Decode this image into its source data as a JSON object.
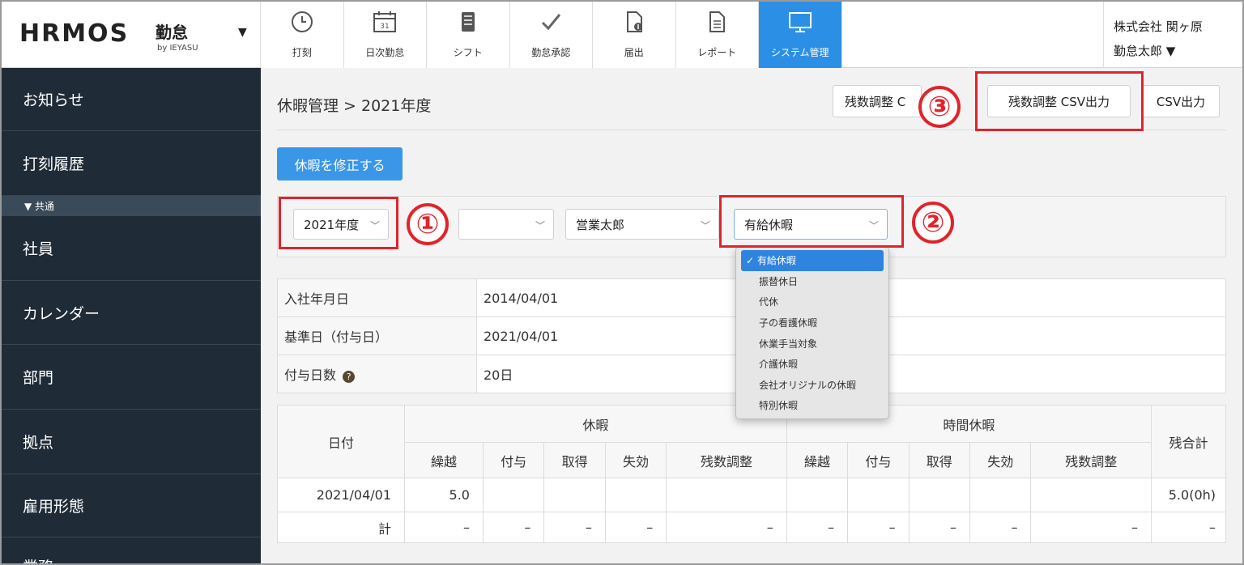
{
  "header": {
    "logo_text": "HRMOS",
    "logo_kintai": "勤怠",
    "logo_by": "by IEYASU",
    "logo_caret": "▼",
    "company": "株式会社 関ヶ原",
    "user": "勤怠太郎 ▼",
    "tabs": [
      {
        "label": "打刻",
        "icon": "clock-icon"
      },
      {
        "label": "日次勤怠",
        "icon": "calendar-icon"
      },
      {
        "label": "シフト",
        "icon": "notebook-icon"
      },
      {
        "label": "勤怠承認",
        "icon": "checkmark-icon"
      },
      {
        "label": "届出",
        "icon": "document-icon"
      },
      {
        "label": "レポート",
        "icon": "report-icon"
      },
      {
        "label": "システム管理",
        "icon": "monitor-icon"
      }
    ]
  },
  "sidebar": {
    "items": [
      "お知らせ",
      "打刻履歴"
    ],
    "section": "▼ 共通",
    "items2": [
      "社員",
      "カレンダー",
      "部門",
      "拠点",
      "雇用形態",
      "業務"
    ]
  },
  "main": {
    "breadcrumb": "休暇管理 > 2021年度",
    "btn_zansu_partial": "残数調整 C",
    "btn_zansu_csv": "残数調整 CSV出力",
    "btn_csv": "CSV出力",
    "btn_edit": "休暇を修正する",
    "filters": {
      "year": "2021年度",
      "blank": "",
      "employee": "営業太郎",
      "leave_type": "有給休暇"
    },
    "annotations": [
      "①",
      "②",
      "③"
    ],
    "dropdown": [
      "✓ 有給休暇",
      "振替休日",
      "代休",
      "子の看護休暇",
      "休業手当対象",
      "介護休暇",
      "会社オリジナルの休暇",
      "特別休暇"
    ],
    "info": [
      {
        "label": "入社年月日",
        "value": "2014/04/01"
      },
      {
        "label": "基準日（付与日）",
        "value": "2021/04/01"
      },
      {
        "label": "付与日数",
        "value": "20日",
        "help": "?"
      }
    ],
    "history": {
      "col_date": "日付",
      "group1": "休暇",
      "group2": "時間休暇",
      "col_total": "残合計",
      "subcols": [
        "繰越",
        "付与",
        "取得",
        "失効",
        "残数調整",
        "繰越",
        "付与",
        "取得",
        "失効",
        "残数調整"
      ],
      "rows": [
        {
          "date": "2021/04/01",
          "cells": [
            "5.0",
            "",
            "",
            "",
            "",
            "",
            "",
            "",
            "",
            ""
          ],
          "total": "5.0(0h)"
        },
        {
          "date": "計",
          "cells": [
            "–",
            "–",
            "–",
            "–",
            "–",
            "–",
            "–",
            "–",
            "–",
            "–"
          ],
          "total": "–"
        }
      ]
    }
  },
  "colors": {
    "accent": "#2c8fe6",
    "sidebar": "#1f2b37",
    "annotation": "#e0242a"
  }
}
